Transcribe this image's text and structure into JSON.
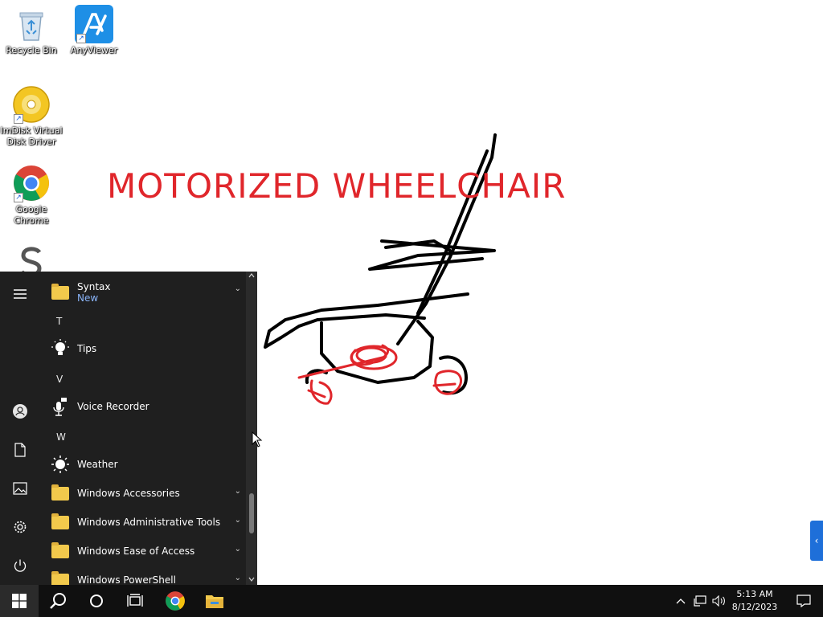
{
  "desktop": {
    "icons": [
      {
        "label": "Recycle Bin"
      },
      {
        "label": "AnyViewer"
      },
      {
        "label": "ImDisk Virtual Disk Driver"
      },
      {
        "label": "Google Chrome"
      }
    ],
    "drawing_title": "MOTORIZED WHEELCHAIR"
  },
  "start_menu": {
    "items": [
      {
        "type": "app",
        "label": "Syntax",
        "sublabel": "New",
        "icon": "folder-icon",
        "expandable": true
      },
      {
        "type": "letter",
        "label": "T"
      },
      {
        "type": "app",
        "label": "Tips",
        "icon": "lightbulb-icon"
      },
      {
        "type": "letter",
        "label": "V"
      },
      {
        "type": "app",
        "label": "Voice Recorder",
        "icon": "microphone-icon"
      },
      {
        "type": "letter",
        "label": "W"
      },
      {
        "type": "app",
        "label": "Weather",
        "icon": "sun-icon"
      },
      {
        "type": "app",
        "label": "Windows Accessories",
        "icon": "folder-icon",
        "expandable": true
      },
      {
        "type": "app",
        "label": "Windows Administrative Tools",
        "icon": "folder-icon",
        "expandable": true
      },
      {
        "type": "app",
        "label": "Windows Ease of Access",
        "icon": "folder-icon",
        "expandable": true
      },
      {
        "type": "app",
        "label": "Windows PowerShell",
        "icon": "folder-icon",
        "expandable": true
      }
    ],
    "rail": [
      "hamburger-icon",
      "user-icon",
      "documents-icon",
      "pictures-icon",
      "settings-icon",
      "power-icon"
    ],
    "new_label_color": "#8ab4f8"
  },
  "taskbar": {
    "pinned": [
      "start-icon",
      "search-icon",
      "cortana-icon",
      "task-view-icon",
      "chrome-icon",
      "file-explorer-icon"
    ],
    "time": "5:13 AM",
    "date": "8/12/2023"
  },
  "colors": {
    "accent": "#1e6fd9",
    "taskbar": "#101010",
    "start_bg": "#1f1f1f",
    "sketch_red": "#e0262b"
  }
}
